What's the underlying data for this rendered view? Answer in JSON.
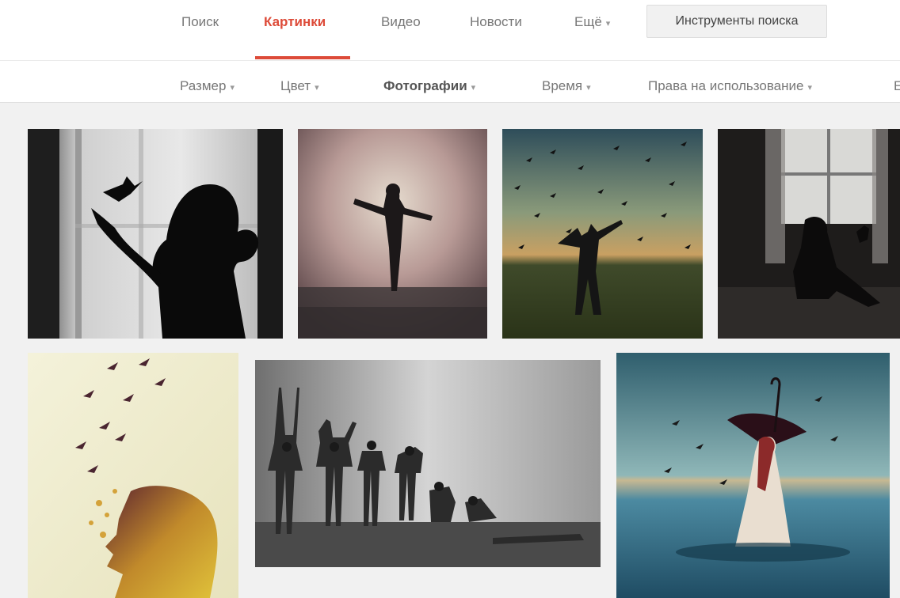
{
  "tabs": [
    {
      "label": "Поиск",
      "active": false
    },
    {
      "label": "Картинки",
      "active": true
    },
    {
      "label": "Видео",
      "active": false
    },
    {
      "label": "Новости",
      "active": false
    },
    {
      "label": "Ещё",
      "active": false,
      "has_caret": true
    }
  ],
  "tools_button": "Инструменты поиска",
  "filters": [
    {
      "label": "Размер",
      "bold": false
    },
    {
      "label": "Цвет",
      "bold": false
    },
    {
      "label": "Фотографии",
      "bold": true
    },
    {
      "label": "Время",
      "bold": false
    },
    {
      "label": "Права на использование",
      "bold": false
    },
    {
      "label": "Е",
      "bold": false
    }
  ],
  "caret": "▾",
  "colors": {
    "accent": "#dd4b39",
    "grid_background": "#f1f1f1"
  },
  "images": [
    {
      "name": "silhouette-hummingbird-image"
    },
    {
      "name": "dancer-arms-open-image"
    },
    {
      "name": "birds-field-image"
    },
    {
      "name": "window-bird-image"
    },
    {
      "name": "watercolor-profile-birds-image"
    },
    {
      "name": "dancers-bw-image"
    },
    {
      "name": "umbrella-sea-image"
    }
  ]
}
